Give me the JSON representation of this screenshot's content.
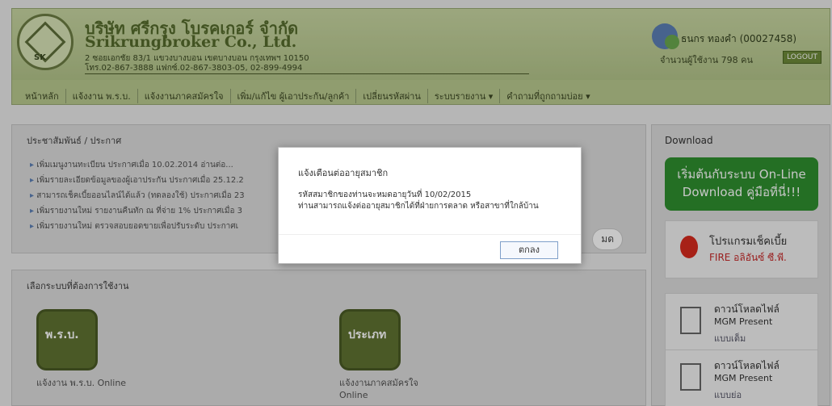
{
  "header": {
    "company_th": "บริษัท ศรีกรุง โบรคเกอร์ จำกัด",
    "company_en": "Srikrungbroker Co., Ltd.",
    "address_line1": "2 ซอยเอกชัย 83/1 แขวงบางบอน เขตบางบอน กรุงเทพฯ 10150",
    "address_line2": "โทร.02-867-3888 แฟกซ์.02-867-3803-05, 02-899-4994",
    "logo_text": "SK",
    "user_name": "ธนกร ทองคำ (00027458)",
    "user_count": "จำนวนผู้ใช้งาน 798 คน",
    "logout_label": "LOGOUT"
  },
  "menu": [
    "หน้าหลัก",
    "แจ้งงาน พ.ร.บ.",
    "แจ้งงานภาคสมัครใจ",
    "เพิ่ม/แก้ไข ผู้เอาประกัน/ลูกค้า",
    "เปลี่ยนรหัสผ่าน",
    "ระบบรายงาน ▾",
    "คำถามที่ถูกถามบ่อย ▾"
  ],
  "news": {
    "title": "ประชาสัมพันธ์ / ประกาศ",
    "items": [
      "เพิ่มเมนูงานทะเบียน ประกาศเมื่อ 10.02.2014 อ่านต่อ...",
      "เพิ่มรายละเอียดข้อมูลของผู้เอาประกัน ประกาศเมื่อ 25.12.2",
      "สามารถเช็คเบี้ยออนไลน์ได้แล้ว (ทดลองใช้) ประกาศเมื่อ 23",
      "เพิ่มรายงานใหม่ รายงานคืนทัก ณ ที่จ่าย 1% ประกาศเมื่อ 3",
      "เพิ่มรายงานใหม่ ตรวจสอบยอดขายเพื่อปรับระดับ ประกาศเ"
    ],
    "more_label": "มด"
  },
  "systems": {
    "title": "เลือกระบบที่ต้องการใช้งาน",
    "items": [
      {
        "label": "แจ้งงาน พ.ร.บ. Online",
        "icon_text": "พ.ร.บ."
      },
      {
        "label": "แจ้งงานภาคสมัครใจ Online",
        "icon_text": "ประเภท"
      }
    ]
  },
  "download": {
    "title": "Download",
    "btn_line1": "เริ่มต้นกับระบบ On-Line",
    "btn_line2": "Download คู่มือที่นี่!!!",
    "fire_line1": "โปรแกรมเช็คเบี้ย",
    "fire_line2": "FIRE อลิอันซ์ ซี.พี.",
    "mgm1_line1": "ดาวน์โหลดไฟล์",
    "mgm1_line2": "MGM Present",
    "mgm1_line3": "แบบเต็ม",
    "mgm2_line1": "ดาวน์โหลดไฟล์",
    "mgm2_line2": "MGM Present",
    "mgm2_line3": "แบบย่อ"
  },
  "modal": {
    "title": "แจ้งเตือนต่ออายุสมาชิก",
    "line1": "รหัสสมาชิกของท่านจะหมดอายุวันที่ 10/02/2015",
    "line2": "ท่านสามารถแจ้งต่ออายุสมาชิกได้ที่ฝ่ายการตลาด หรือสาขาที่ใกล้บ้าน",
    "ok_label": "ตกลง"
  }
}
